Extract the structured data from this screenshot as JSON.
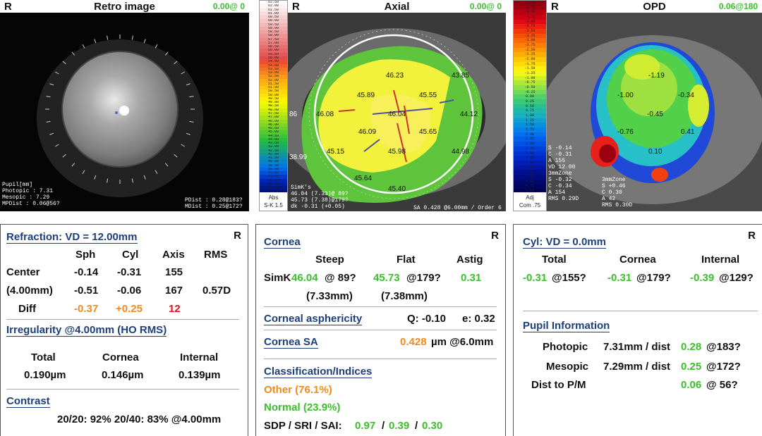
{
  "retro": {
    "r": "R",
    "title": "Retro image",
    "value": "0.00@ 0",
    "pupil_lines": [
      "Pupil[mm]",
      "Photopic : 7.31",
      "Mesopic : 7.29",
      "MPDist : 0.06@56?"
    ],
    "pdist_lines": [
      "PDist : 0.28@183?",
      "MDist : 0.25@172?"
    ]
  },
  "axial_scale": {
    "values": [
      "62.50",
      "62.00",
      "61.50",
      "61.00",
      "60.50",
      "60.00",
      "59.50",
      "59.00",
      "58.50",
      "58.00",
      "57.50",
      "57.00",
      "56.50",
      "56.00",
      "55.50",
      "55.00",
      "54.50",
      "54.00",
      "53.50",
      "53.00",
      "52.50",
      "52.00",
      "51.50",
      "51.00",
      "50.50",
      "50.00",
      "49.50",
      "49.00",
      "48.50",
      "48.00",
      "47.50",
      "47.00",
      "46.50",
      "46.00",
      "45.50",
      "45.00",
      "44.50",
      "44.00",
      "43.50",
      "43.00",
      "42.50",
      "42.00",
      "41.00",
      "40.00",
      "39.00",
      "38.00",
      "37.50",
      "37.00",
      "36.00",
      "35.00",
      "34.00",
      "33.00"
    ],
    "foot": [
      "Abs",
      "S-K 1.5"
    ],
    "colors": [
      "#ffffff",
      "#fdf4f4",
      "#fbe8e8",
      "#f9dcdc",
      "#f7d0d0",
      "#f5c4c4",
      "#f3b8b8",
      "#f1acac",
      "#efa0a0",
      "#ed9494",
      "#eb8888",
      "#e97c7c",
      "#e77070",
      "#e56464",
      "#e35858",
      "#e14c4c",
      "#ef4e2e",
      "#f26128",
      "#f47324",
      "#f7861f",
      "#f9981a",
      "#fcab15",
      "#feb911",
      "#fec70e",
      "#ffd50b",
      "#ffe208",
      "#fff006",
      "#f4f800",
      "#e6f406",
      "#d2ee0c",
      "#bde812",
      "#a8e118",
      "#93db1e",
      "#7ed524",
      "#69cf2a",
      "#54c930",
      "#3fc336",
      "#2abd3c",
      "#20b552",
      "#1bab6a",
      "#16a182",
      "#11979a",
      "#0c8db2",
      "#0783ca",
      "#0279e2",
      "#0066e8",
      "#0050d8",
      "#003ac8",
      "#0024b8",
      "#001ea0",
      "#001888",
      "#001270"
    ]
  },
  "axial": {
    "r": "R",
    "title": "Axial",
    "value": "0.00@ 0",
    "readings": [
      "46.23",
      "43.85",
      "45.89",
      "45.55",
      "46.08",
      "46.04",
      "44.12",
      "46.09",
      "45.65",
      "45.15",
      "45.98",
      "44.98",
      "45.64",
      "45.40",
      "86",
      "38.99"
    ],
    "simk_lines": [
      "SimK's",
      "46.04 (7.33)@ 89?",
      "45.73 (7.38)@179?",
      "dk -0.31 (+0.05)"
    ],
    "sa_line": "SA 0.428 @6.00mm / Order 6"
  },
  "opd_scale": {
    "values": [
      "-5.00",
      "-4.75",
      "-4.50",
      "-4.25",
      "-4.00",
      "-3.75",
      "-3.50",
      "-3.25",
      "-3.00",
      "-2.75",
      "-2.50",
      "-2.25",
      "-2.00",
      "-1.75",
      "-1.50",
      "-1.25",
      "-1.00",
      "-0.75",
      "-0.50",
      "-0.25",
      "0.00",
      "0.25",
      "0.50",
      "0.75",
      "1.00",
      "1.25",
      "1.50",
      "1.75",
      "2.00",
      "2.25",
      "2.50",
      "2.75",
      "3.00",
      "3.25",
      "3.50",
      "3.75",
      "4.00",
      "4.25",
      "4.50",
      "4.75",
      "5.00"
    ],
    "foot": [
      "Adj",
      "Com .75"
    ],
    "colors": [
      "#8a0010",
      "#a00010",
      "#b80012",
      "#d00014",
      "#e00a14",
      "#ee2010",
      "#f5380c",
      "#f85008",
      "#fb6806",
      "#fd8004",
      "#fe9804",
      "#ffb004",
      "#ffc804",
      "#ffdc08",
      "#fff010",
      "#f0f818",
      "#d0f028",
      "#b0e838",
      "#90e048",
      "#70d858",
      "#50d068",
      "#38c878",
      "#28c090",
      "#20b8a8",
      "#18b0c0",
      "#10a0d0",
      "#0890e0",
      "#0480ec",
      "#0070f0",
      "#0060ec",
      "#0050e4",
      "#0040dc",
      "#0034d0",
      "#0028c4",
      "#001eb4",
      "#0016a4",
      "#001090",
      "#000c80",
      "#000870",
      "#000660",
      "#000450"
    ]
  },
  "opd": {
    "r": "R",
    "title": "OPD",
    "value": "0.06@180",
    "readings": [
      "-1.19",
      "-1.00",
      "-0.34",
      "-0.45",
      "-0.76",
      "0.41",
      "0.10"
    ],
    "left_lines": [
      "S -0.14",
      "C -0.31",
      "A 155",
      "VD 12.00",
      "3mmZone",
      "S -0.32",
      "C -0.34",
      "A 154",
      "RMS 0.29D"
    ],
    "right_lines": [
      "3mmZone",
      "S +0.46",
      "C 0.30",
      "A 42",
      "RMS 0.30D"
    ]
  },
  "refraction": {
    "title": "Refraction: VD = 12.00mm",
    "r": "R",
    "col_headers": [
      "Sph",
      "Cyl",
      "Axis",
      "RMS"
    ],
    "rows": [
      {
        "label": "Center",
        "sph": "-0.14",
        "cyl": "-0.31",
        "axis": "155",
        "rms": ""
      },
      {
        "label": "(4.00mm)",
        "sph": "-0.51",
        "cyl": "-0.06",
        "axis": "167",
        "rms": "0.57D"
      },
      {
        "label": "Diff",
        "sph": "-0.37",
        "cyl": "+0.25",
        "axis": "12",
        "rms": ""
      }
    ],
    "irregularity_title": "Irregularity @4.00mm (HO RMS)",
    "irr_headers": [
      "Total",
      "Cornea",
      "Internal"
    ],
    "irr_values": [
      "0.190µm",
      "0.146µm",
      "0.139µm"
    ],
    "contrast_title": "Contrast",
    "contrast_text": "20/20: 92%  20/40: 83%  @4.00mm"
  },
  "cornea": {
    "title": "Cornea",
    "r": "R",
    "col_headers": [
      "Steep",
      "Flat",
      "Astig"
    ],
    "simk_label": "SimK",
    "steep_val": "46.04",
    "steep_axis": "@ 89?",
    "flat_val": "45.73",
    "flat_axis": "@179?",
    "astig_val": "0.31",
    "steep_mm": "(7.33mm)",
    "flat_mm": "(7.38mm)",
    "asphericity_title": "Corneal asphericity",
    "q_text": "Q: -0.10",
    "e_text": "e: 0.32",
    "sa_title": "Cornea SA",
    "sa_value": "0.428",
    "sa_unit": "µm @6.0mm",
    "class_title": "Classification/Indices",
    "other_text": "Other (76.1%)",
    "normal_text": "Normal (23.9%)",
    "indices_label": "SDP / SRI / SAI:",
    "sdp": "0.97",
    "sep1": "/",
    "sri": "0.39",
    "sep2": "/",
    "sai": "0.30"
  },
  "cyl": {
    "title": "Cyl: VD = 0.0mm",
    "r": "R",
    "col_headers": [
      "Total",
      "Cornea",
      "Internal"
    ],
    "total_val": "-0.31",
    "total_axis": "@155?",
    "cornea_val": "-0.31",
    "cornea_axis": "@179?",
    "internal_val": "-0.39",
    "internal_axis": "@129?",
    "pupil_title": "Pupil Information",
    "photopic_label": "Photopic",
    "photopic_mm": "7.31mm / dist",
    "photopic_dist": "0.28",
    "photopic_axis": "@183?",
    "mesopic_label": "Mesopic",
    "mesopic_mm": "7.29mm / dist",
    "mesopic_dist": "0.25",
    "mesopic_axis": "@172?",
    "dist_label": "Dist to P/M",
    "dist_val": "0.06",
    "dist_axis": "@ 56?"
  },
  "colors": {
    "title_blue": "#1e3f7a",
    "green": "#3cbf2c",
    "orange": "#f28a1e",
    "red": "#e0141e"
  }
}
